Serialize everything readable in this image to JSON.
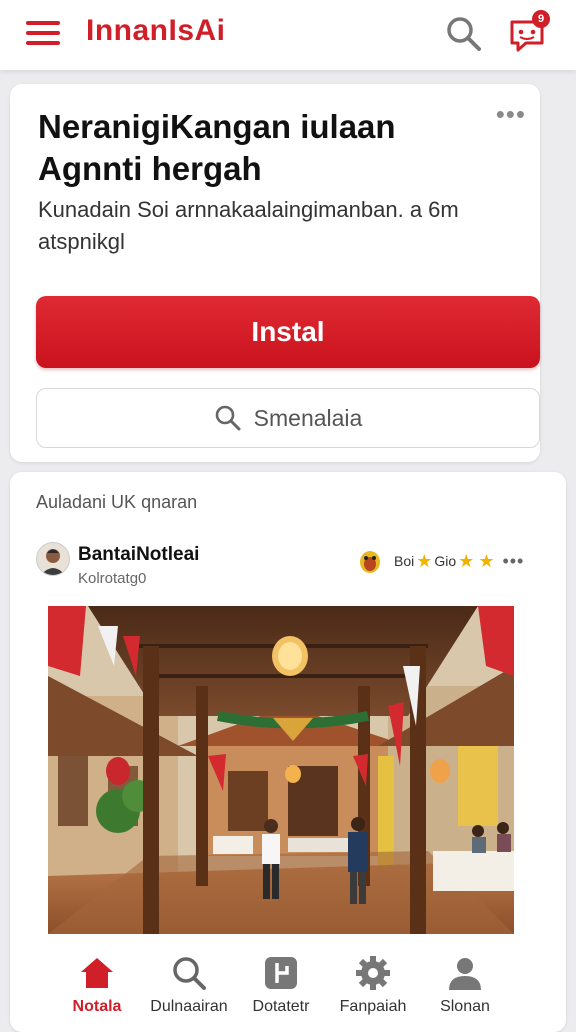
{
  "header": {
    "brand": "InnanIsAi",
    "chat_badge": "9"
  },
  "promo": {
    "title": "NeranigiKangan iulaan Agnnti hergah",
    "description": "Kunadain Soi arnnakaalaingimanban. a 6m atspnikgl",
    "install_label": "Instal",
    "search_label": "Smenalaia"
  },
  "feed": {
    "section_label": "Auladani UK qnaran",
    "post": {
      "author": "BantaiNotleai",
      "subtitle": "Kolrotatg0",
      "meta1": "Boi",
      "meta2": "Gio"
    }
  },
  "nav": {
    "items": [
      {
        "label": "Notala",
        "icon": "home-icon",
        "active": true
      },
      {
        "label": "Dulnaairan",
        "icon": "search-icon",
        "active": false
      },
      {
        "label": "Dotatetr",
        "icon": "bookmark-icon",
        "active": false
      },
      {
        "label": "Fanpaiah",
        "icon": "gear-icon",
        "active": false
      },
      {
        "label": "Slonan",
        "icon": "user-icon",
        "active": false
      }
    ]
  },
  "colors": {
    "accent": "#d11f2a",
    "background": "#ececee"
  }
}
